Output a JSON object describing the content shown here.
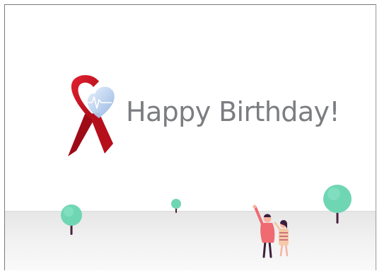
{
  "card": {
    "title": "Happy Birthday!"
  },
  "icons": {
    "logo": "red-ribbon-heart-icon",
    "trees": "round-tree-icon",
    "people": "two-people-pointing-illustration"
  },
  "colors": {
    "ribbon": "#c2101f",
    "heart": "#b9d2ee",
    "title": "#7b7d80",
    "tree": "#6fd6b4",
    "trunk": "#4a2140",
    "ground": "#ebebeb"
  }
}
